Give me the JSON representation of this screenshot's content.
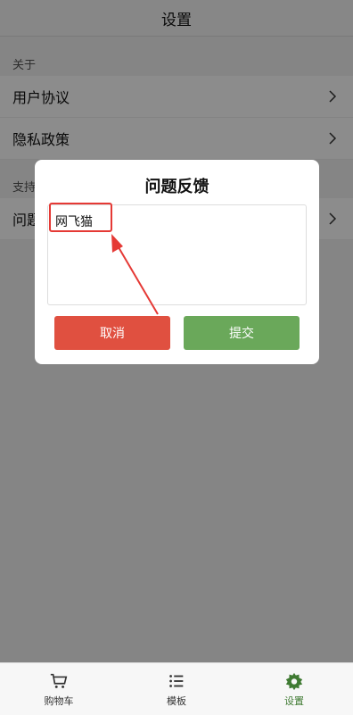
{
  "header": {
    "title": "设置"
  },
  "sections": [
    {
      "label": "关于",
      "items": [
        {
          "label": "用户协议"
        },
        {
          "label": "隐私政策"
        }
      ]
    },
    {
      "label": "支持",
      "items": [
        {
          "label": "问题"
        }
      ]
    }
  ],
  "dialog": {
    "title": "问题反馈",
    "textarea_value": "网飞猫",
    "cancel_label": "取消",
    "submit_label": "提交"
  },
  "bottom_nav": {
    "items": [
      {
        "label": "购物车",
        "icon": "cart-icon"
      },
      {
        "label": "模板",
        "icon": "list-icon"
      },
      {
        "label": "设置",
        "icon": "gear-icon",
        "active": true
      }
    ]
  },
  "colors": {
    "cancel": "#e05040",
    "submit": "#6aa85a",
    "highlight": "#e53935",
    "active_nav": "#3f7a32"
  }
}
